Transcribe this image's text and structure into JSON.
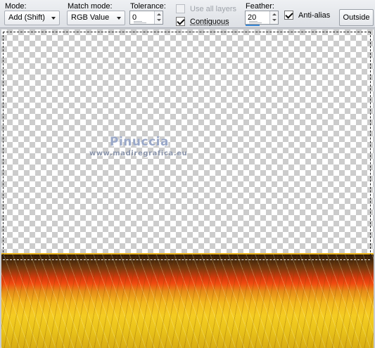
{
  "toolbar": {
    "mode": {
      "label": "Mode:",
      "value": "Add (Shift)"
    },
    "match_mode": {
      "label": "Match mode:",
      "value": "RGB Value"
    },
    "tolerance": {
      "label": "Tolerance:",
      "value": "0"
    },
    "use_all_layers": {
      "label": "Use all layers",
      "checked": false,
      "enabled": false
    },
    "contiguous": {
      "label": "Contiguous",
      "checked": true
    },
    "feather": {
      "label": "Feather:",
      "value": "20"
    },
    "anti_alias": {
      "label": "Anti-alias",
      "checked": true
    },
    "outside_button": {
      "label": "Outside"
    }
  },
  "canvas": {
    "watermark": {
      "name": "Pinuccia",
      "url": "www.madiregrafica.eu"
    }
  },
  "colors": {
    "toolbar_bg": "#dde0e5",
    "checker_light": "#ffffff",
    "checker_dark": "#cccccc",
    "slider_accent": "#3b89d6"
  }
}
